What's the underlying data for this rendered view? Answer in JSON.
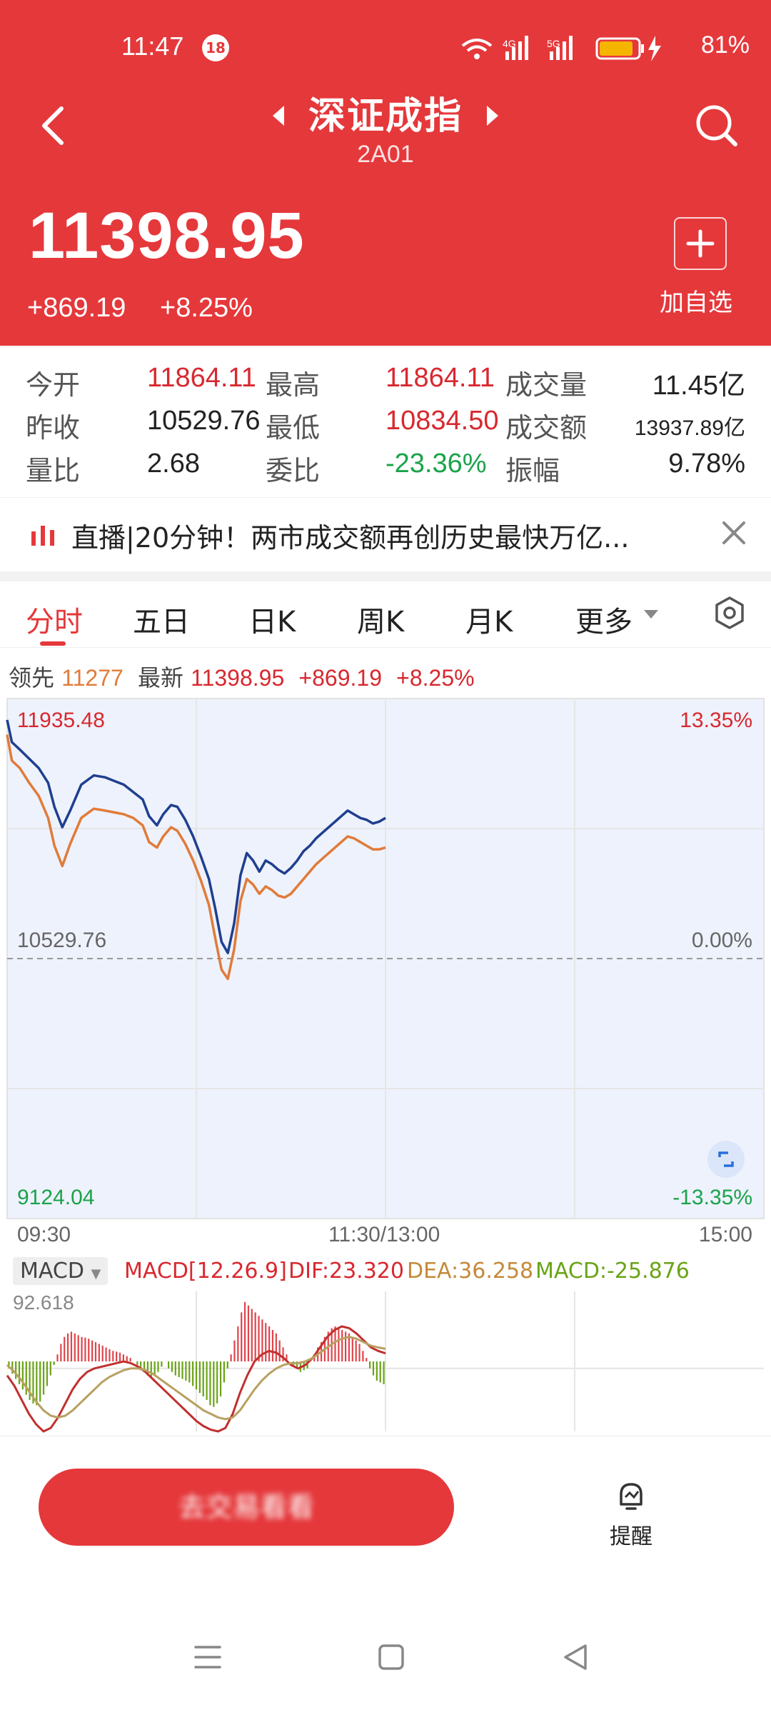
{
  "status_bar": {
    "time": "11:47",
    "badge": "18",
    "battery": "81%"
  },
  "header": {
    "title": "深证成指",
    "code": "2A01",
    "price": "11398.95",
    "change": "+869.19",
    "change_pct": "+8.25%",
    "add_watch_label": "加自选"
  },
  "stats": [
    {
      "label": "今开",
      "value": "11864.11",
      "tone": "red"
    },
    {
      "label": "最高",
      "value": "11864.11",
      "tone": "red"
    },
    {
      "label": "成交量",
      "value": "11.45亿",
      "tone": "black"
    },
    {
      "label": "昨收",
      "value": "10529.76",
      "tone": "black"
    },
    {
      "label": "最低",
      "value": "10834.50",
      "tone": "red"
    },
    {
      "label": "成交额",
      "value": "13937.89亿",
      "tone": "black"
    },
    {
      "label": "量比",
      "value": "2.68",
      "tone": "black"
    },
    {
      "label": "委比",
      "value": "-23.36%",
      "tone": "green"
    },
    {
      "label": "振幅",
      "value": "9.78%",
      "tone": "black"
    }
  ],
  "news": {
    "text": "直播|20分钟！两市成交额再创历史最快万亿..."
  },
  "tabs": [
    "分时",
    "五日",
    "日K",
    "周K",
    "月K",
    "更多"
  ],
  "lead_line": {
    "lead_label": "领先",
    "lead_value": "11277",
    "latest_label": "最新",
    "latest_value": "11398.95",
    "change": "+869.19",
    "change_pct": "+8.25%"
  },
  "chart_data": [
    {
      "type": "line",
      "y_labels": {
        "top": "11935.48",
        "mid": "10529.76",
        "bottom": "9124.04"
      },
      "pct_labels": {
        "top": "13.35%",
        "mid": "0.00%",
        "bottom": "-13.35%"
      },
      "ylim": [
        9124.04,
        11935.48
      ],
      "x_labels": [
        "09:30",
        "11:30/13:00",
        "15:00"
      ],
      "session_minutes": 240,
      "series": [
        {
          "color": "#1f3f8f",
          "x": [
            0,
            3,
            8,
            14,
            20,
            26,
            30,
            35,
            40,
            47,
            55,
            62,
            68,
            74,
            80,
            86,
            90,
            95,
            99,
            104,
            108,
            113,
            118,
            123,
            128,
            132,
            136,
            140,
            144,
            148,
            152,
            156,
            160,
            164,
            168,
            172,
            176,
            180,
            184,
            188,
            192,
            196,
            200,
            204,
            208,
            212,
            216,
            220,
            224,
            228,
            232,
            236,
            240
          ],
          "values": [
            11820,
            11700,
            11660,
            11610,
            11560,
            11480,
            11350,
            11240,
            11330,
            11470,
            11520,
            11510,
            11490,
            11470,
            11430,
            11390,
            11300,
            11250,
            11310,
            11360,
            11350,
            11280,
            11190,
            11080,
            10960,
            10800,
            10620,
            10560,
            10720,
            10980,
            11100,
            11060,
            11000,
            11060,
            11040,
            11010,
            10990,
            11020,
            11060,
            11110,
            11140,
            11180,
            11210,
            11240,
            11270,
            11300,
            11330,
            11310,
            11290,
            11280,
            11260,
            11270,
            11290
          ]
        },
        {
          "color": "#e07b39",
          "x": [
            0,
            3,
            8,
            14,
            20,
            26,
            30,
            35,
            40,
            47,
            55,
            62,
            68,
            74,
            80,
            86,
            90,
            95,
            99,
            104,
            108,
            113,
            118,
            123,
            128,
            132,
            136,
            140,
            144,
            148,
            152,
            156,
            160,
            164,
            168,
            172,
            176,
            180,
            184,
            188,
            192,
            196,
            200,
            204,
            208,
            212,
            216,
            220,
            224,
            228,
            232,
            236,
            240
          ],
          "values": [
            11740,
            11600,
            11560,
            11480,
            11410,
            11290,
            11140,
            11030,
            11150,
            11290,
            11340,
            11330,
            11320,
            11310,
            11290,
            11250,
            11160,
            11130,
            11190,
            11240,
            11220,
            11150,
            11060,
            10950,
            10820,
            10640,
            10470,
            10420,
            10580,
            10840,
            10960,
            10930,
            10880,
            10920,
            10900,
            10870,
            10860,
            10880,
            10920,
            10960,
            11000,
            11040,
            11070,
            11100,
            11130,
            11160,
            11190,
            11180,
            11160,
            11140,
            11120,
            11120,
            11130
          ]
        }
      ]
    },
    {
      "type": "bar",
      "title": "MACD",
      "params": "MACD[12.26.9]",
      "dif": "DIF:23.320",
      "dea": "DEA:36.258",
      "macd": "MACD:-25.876",
      "top_label": "92.618",
      "ylim": [
        -200,
        200
      ],
      "bars": [
        -20,
        -35,
        -50,
        -65,
        -80,
        -95,
        -110,
        -120,
        -125,
        -115,
        -95,
        -70,
        -40,
        -10,
        20,
        50,
        70,
        80,
        85,
        80,
        75,
        70,
        68,
        65,
        60,
        55,
        50,
        45,
        40,
        35,
        30,
        28,
        25,
        20,
        15,
        10,
        0,
        -10,
        -20,
        -30,
        -40,
        -45,
        -40,
        -30,
        -15,
        0,
        -20,
        -30,
        -40,
        -45,
        -50,
        -55,
        -60,
        -70,
        -80,
        -90,
        -100,
        -110,
        -125,
        -130,
        -120,
        -100,
        -60,
        -20,
        20,
        60,
        100,
        140,
        170,
        160,
        150,
        140,
        130,
        120,
        110,
        100,
        90,
        80,
        60,
        40,
        20,
        0,
        -10,
        -20,
        -30,
        -25,
        -20,
        0,
        20,
        40,
        55,
        70,
        85,
        95,
        100,
        95,
        90,
        85,
        80,
        70,
        60,
        50,
        30,
        10,
        -20,
        -40,
        -55,
        -60,
        -65
      ],
      "dif_line": [
        -40,
        -70,
        -110,
        -150,
        -180,
        -200,
        -190,
        -160,
        -120,
        -80,
        -50,
        -30,
        -20,
        -15,
        -10,
        -5,
        0,
        -5,
        -15,
        -30,
        -50,
        -70,
        -90,
        -110,
        -130,
        -150,
        -170,
        -185,
        -195,
        -200,
        -190,
        -150,
        -90,
        -40,
        0,
        20,
        30,
        25,
        10,
        -10,
        -20,
        -10,
        10,
        40,
        70,
        90,
        100,
        95,
        80,
        60,
        40,
        30,
        23
      ],
      "dea_line": [
        -10,
        -30,
        -55,
        -85,
        -115,
        -140,
        -155,
        -160,
        -155,
        -140,
        -120,
        -100,
        -80,
        -60,
        -45,
        -35,
        -25,
        -20,
        -20,
        -25,
        -35,
        -50,
        -65,
        -80,
        -95,
        -110,
        -125,
        -140,
        -150,
        -160,
        -165,
        -160,
        -140,
        -110,
        -80,
        -55,
        -35,
        -20,
        -10,
        -5,
        -5,
        0,
        10,
        25,
        40,
        55,
        65,
        70,
        65,
        55,
        45,
        40,
        36
      ]
    }
  ],
  "macd_selector": "MACD",
  "bottom": {
    "trade_button": "去交易看看",
    "alert_label": "提醒"
  },
  "colors": {
    "brand_red": "#e5383b",
    "up": "#d8282f",
    "down": "#1aa34a"
  }
}
